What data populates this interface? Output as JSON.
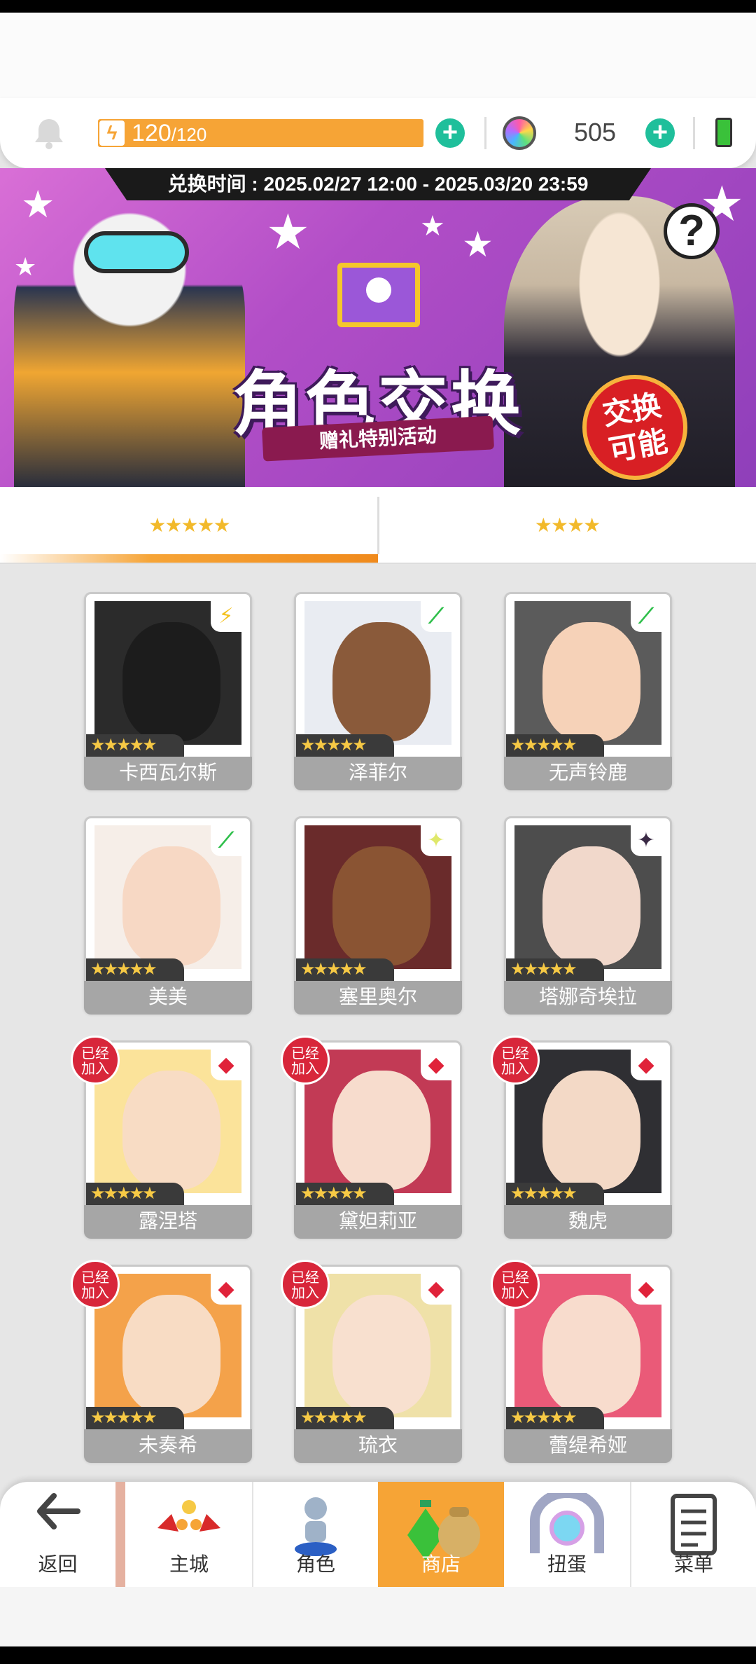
{
  "resources": {
    "energy_current": "120",
    "energy_max": "/120",
    "gems": "505"
  },
  "banner": {
    "exchange_time": "兑换时间 : 2025.02/27 12:00 - 2025.03/20 23:59",
    "title": "角色交换",
    "subtitle": "赠礼特别活动",
    "badge_line1": "交换",
    "badge_line2": "可能",
    "help": "?"
  },
  "tabs": [
    {
      "label": "★★★★★",
      "active": true
    },
    {
      "label": "★★★★",
      "active": false
    }
  ],
  "characters": [
    {
      "name": "卡西瓦尔斯",
      "element": "⚡",
      "elem_color": "#f4c21f",
      "joined": false,
      "bg": "#2b2b2b",
      "face": "#1c1c1c",
      "stars": "★★★★★"
    },
    {
      "name": "泽菲尔",
      "element": "⟋",
      "elem_color": "#2fbf4b",
      "joined": false,
      "bg": "#e9ecf2",
      "face": "#8a5a3a",
      "stars": "★★★★★"
    },
    {
      "name": "无声铃鹿",
      "element": "⟋",
      "elem_color": "#2fbf4b",
      "joined": false,
      "bg": "#5b5b5b",
      "face": "#f6d2b8",
      "stars": "★★★★★"
    },
    {
      "name": "美美",
      "element": "⟋",
      "elem_color": "#2fbf4b",
      "joined": false,
      "bg": "#f6eee8",
      "face": "#f7d8c4",
      "stars": "★★★★★"
    },
    {
      "name": "塞里奥尔",
      "element": "✦",
      "elem_color": "#dfe86a",
      "joined": false,
      "bg": "#6a2b2b",
      "face": "#8a5433",
      "stars": "★★★★★"
    },
    {
      "name": "塔娜奇埃拉",
      "element": "✦",
      "elem_color": "#3a2a45",
      "joined": false,
      "bg": "#4d4d4d",
      "face": "#f1d8cb",
      "stars": "★★★★★"
    },
    {
      "name": "露涅塔",
      "element": "◆",
      "elem_color": "#e0233a",
      "joined": true,
      "bg": "#fbe39a",
      "face": "#f8dcc4",
      "stars": "★★★★★"
    },
    {
      "name": "黛妲莉亚",
      "element": "◆",
      "elem_color": "#e0233a",
      "joined": true,
      "bg": "#c23a55",
      "face": "#f7dccd",
      "stars": "★★★★★"
    },
    {
      "name": "魏虎",
      "element": "◆",
      "elem_color": "#e0233a",
      "joined": true,
      "bg": "#2f2f33",
      "face": "#f3d9c6",
      "stars": "★★★★★"
    },
    {
      "name": "未奏希",
      "element": "◆",
      "elem_color": "#e0233a",
      "joined": true,
      "bg": "#f4a24a",
      "face": "#f8dcc4",
      "stars": "★★★★★"
    },
    {
      "name": "琉衣",
      "element": "◆",
      "elem_color": "#e0233a",
      "joined": true,
      "bg": "#efe1a8",
      "face": "#f8e0cf",
      "stars": "★★★★★"
    },
    {
      "name": "蕾缇希娅",
      "element": "◆",
      "elem_color": "#e0233a",
      "joined": true,
      "bg": "#ea5a78",
      "face": "#f8dccd",
      "stars": "★★★★★"
    }
  ],
  "joined_label": "已经加入",
  "nav": {
    "back": "返回",
    "main_city": "主城",
    "role": "角色",
    "shop": "商店",
    "gacha": "扭蛋",
    "menu": "菜单"
  },
  "colors": {
    "accent": "#f6a436",
    "plus": "#1fbf9b",
    "joined_badge": "#d8263a"
  }
}
